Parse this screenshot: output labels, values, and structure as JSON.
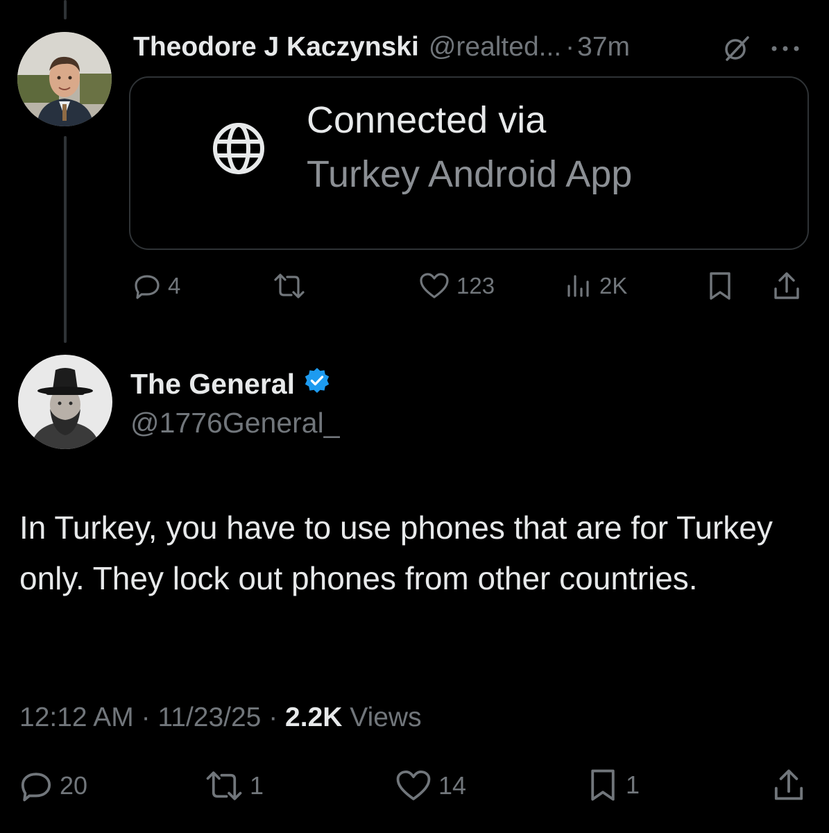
{
  "tweet1": {
    "name": "Theodore J Kaczynski",
    "handle": "@realted...",
    "separator": "·",
    "time": "37m",
    "more_label": "···",
    "card": {
      "title": "Connected via",
      "subtitle": "Turkey Android App",
      "icon": "globe-icon"
    },
    "actions": {
      "replies": "4",
      "reposts": "",
      "likes": "123",
      "views": "2K"
    }
  },
  "tweet2": {
    "name": "The General",
    "handle": "@1776General_",
    "body": "In Turkey, you have to use phones that are for Turkey only. They lock out phones from other countries.",
    "meta": {
      "time": "12:12 AM",
      "sep1": " · ",
      "date": "11/23/25",
      "sep2": " · ",
      "views_count": "2.2K",
      "views_label": " Views"
    },
    "actions": {
      "replies": "20",
      "reposts": "1",
      "likes": "14",
      "bookmarks": "1"
    }
  },
  "colors": {
    "background": "#000000",
    "primary_text": "#e7e9ea",
    "secondary_text": "#71767b",
    "border": "#2f3336",
    "verified": "#1d9bf0"
  }
}
